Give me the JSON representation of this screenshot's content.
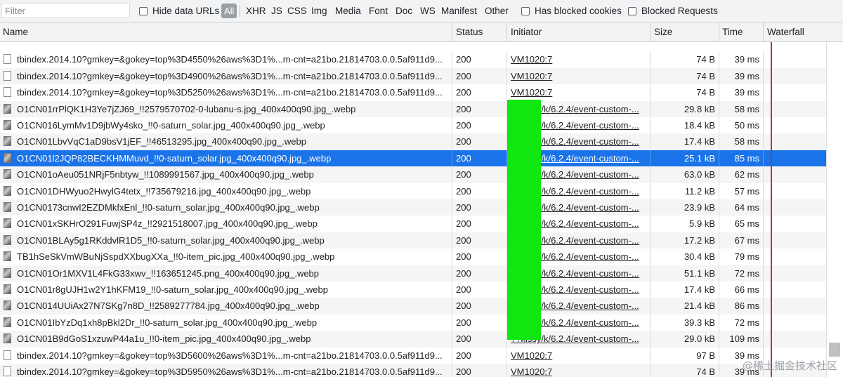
{
  "toolbar": {
    "filter_placeholder": "Filter",
    "hide_data_urls": "Hide data URLs",
    "types": [
      "All",
      "XHR",
      "JS",
      "CSS",
      "Img",
      "Media",
      "Font",
      "Doc",
      "WS",
      "Manifest",
      "Other"
    ],
    "has_blocked_cookies": "Has blocked cookies",
    "blocked_requests": "Blocked Requests"
  },
  "columns": {
    "name": "Name",
    "status": "Status",
    "initiator": "Initiator",
    "size": "Size",
    "time": "Time",
    "waterfall": "Waterfall"
  },
  "rows": [
    {
      "name": "tbindex.2014.10?gmkey=&gokey=top%3D4550%26aws%3D1%...m-cnt=a21bo.21814703.0.0.5af911d9...",
      "status": "200",
      "initiator": "VM1020:7",
      "size": "74 B",
      "time": "39 ms",
      "icon": "doc"
    },
    {
      "name": "tbindex.2014.10?gmkey=&gokey=top%3D4900%26aws%3D1%...m-cnt=a21bo.21814703.0.0.5af911d9...",
      "status": "200",
      "initiator": "VM1020:7",
      "size": "74 B",
      "time": "39 ms",
      "icon": "doc"
    },
    {
      "name": "tbindex.2014.10?gmkey=&gokey=top%3D5250%26aws%3D1%...m-cnt=a21bo.21814703.0.0.5af911d9...",
      "status": "200",
      "initiator": "VM1020:7",
      "size": "74 B",
      "time": "39 ms",
      "icon": "doc"
    },
    {
      "name": "O1CN01rrPlQK1H3Ye7jZJ69_!!2579570702-0-lubanu-s.jpg_400x400q90.jpg_.webp",
      "status": "200",
      "initiator": "??kissy/k/6.2.4/event-custom-...",
      "size": "29.8 kB",
      "time": "58 ms",
      "icon": "img"
    },
    {
      "name": "O1CN016LymMv1D9jbWy4sko_!!0-saturn_solar.jpg_400x400q90.jpg_.webp",
      "status": "200",
      "initiator": "??kissy/k/6.2.4/event-custom-...",
      "size": "18.4 kB",
      "time": "50 ms",
      "icon": "img"
    },
    {
      "name": "O1CN01LbvVqC1aD9bsV1jEF_!!46513295.jpg_400x400q90.jpg_.webp",
      "status": "200",
      "initiator": "??kissy/k/6.2.4/event-custom-...",
      "size": "17.4 kB",
      "time": "58 ms",
      "icon": "img"
    },
    {
      "name": "O1CN01l2JQP82BECKHMMuvd_!!0-saturn_solar.jpg_400x400q90.jpg_.webp",
      "status": "200",
      "initiator": "??kissy/k/6.2.4/event-custom-...",
      "size": "25.1 kB",
      "time": "85 ms",
      "icon": "img",
      "selected": true
    },
    {
      "name": "O1CN01oAeu051NRjF5nbtyw_!!1089991567.jpg_400x400q90.jpg_.webp",
      "status": "200",
      "initiator": "??kissy/k/6.2.4/event-custom-...",
      "size": "63.0 kB",
      "time": "62 ms",
      "icon": "img"
    },
    {
      "name": "O1CN01DHWyuo2HwylG4tetx_!!735679216.jpg_400x400q90.jpg_.webp",
      "status": "200",
      "initiator": "??kissy/k/6.2.4/event-custom-...",
      "size": "11.2 kB",
      "time": "57 ms",
      "icon": "img"
    },
    {
      "name": "O1CN0173cnwI2EZDMkfxEnl_!!0-saturn_solar.jpg_400x400q90.jpg_.webp",
      "status": "200",
      "initiator": "??kissy/k/6.2.4/event-custom-...",
      "size": "23.9 kB",
      "time": "64 ms",
      "icon": "img"
    },
    {
      "name": "O1CN01xSKHrO291FuwjSP4z_!!2921518007.jpg_400x400q90.jpg_.webp",
      "status": "200",
      "initiator": "??kissy/k/6.2.4/event-custom-...",
      "size": "5.9 kB",
      "time": "65 ms",
      "icon": "img"
    },
    {
      "name": "O1CN01BLAy5g1RKddvlR1D5_!!0-saturn_solar.jpg_400x400q90.jpg_.webp",
      "status": "200",
      "initiator": "??kissy/k/6.2.4/event-custom-...",
      "size": "17.2 kB",
      "time": "67 ms",
      "icon": "img"
    },
    {
      "name": "TB1hSeSkVmWBuNjSspdXXbugXXa_!!0-item_pic.jpg_400x400q90.jpg_.webp",
      "status": "200",
      "initiator": "??kissy/k/6.2.4/event-custom-...",
      "size": "30.4 kB",
      "time": "79 ms",
      "icon": "img"
    },
    {
      "name": "O1CN01Or1MXV1L4FkG33xwv_!!163651245.png_400x400q90.jpg_.webp",
      "status": "200",
      "initiator": "??kissy/k/6.2.4/event-custom-...",
      "size": "51.1 kB",
      "time": "72 ms",
      "icon": "img"
    },
    {
      "name": "O1CN01r8gUJH1w2Y1hKFM19_!!0-saturn_solar.jpg_400x400q90.jpg_.webp",
      "status": "200",
      "initiator": "??kissy/k/6.2.4/event-custom-...",
      "size": "17.4 kB",
      "time": "66 ms",
      "icon": "img"
    },
    {
      "name": "O1CN014UUiAx27N7SKg7n8D_!!2589277784.jpg_400x400q90.jpg_.webp",
      "status": "200",
      "initiator": "??kissy/k/6.2.4/event-custom-...",
      "size": "21.4 kB",
      "time": "86 ms",
      "icon": "img"
    },
    {
      "name": "O1CN01IbYzDq1xh8pBkl2Dr_!!0-saturn_solar.jpg_400x400q90.jpg_.webp",
      "status": "200",
      "initiator": "??kissy/k/6.2.4/event-custom-...",
      "size": "39.3 kB",
      "time": "72 ms",
      "icon": "img"
    },
    {
      "name": "O1CN01B9dGoS1xzuwP44a1u_!!0-item_pic.jpg_400x400q90.jpg_.webp",
      "status": "200",
      "initiator": "??kissy/k/6.2.4/event-custom-...",
      "size": "29.0 kB",
      "time": "109 ms",
      "icon": "img"
    },
    {
      "name": "tbindex.2014.10?gmkey=&gokey=top%3D5600%26aws%3D1%...m-cnt=a21bo.21814703.0.0.5af911d9...",
      "status": "200",
      "initiator": "VM1020:7",
      "size": "97 B",
      "time": "39 ms",
      "icon": "doc"
    },
    {
      "name": "tbindex.2014.10?gmkey=&gokey=top%3D5950%26aws%3D1%...m-cnt=a21bo.21814703.0.0.5af911d9...",
      "status": "200",
      "initiator": "VM1020:7",
      "size": "74 B",
      "time": "39 ms",
      "icon": "doc"
    }
  ],
  "watermark": "@稀土掘金技术社区"
}
